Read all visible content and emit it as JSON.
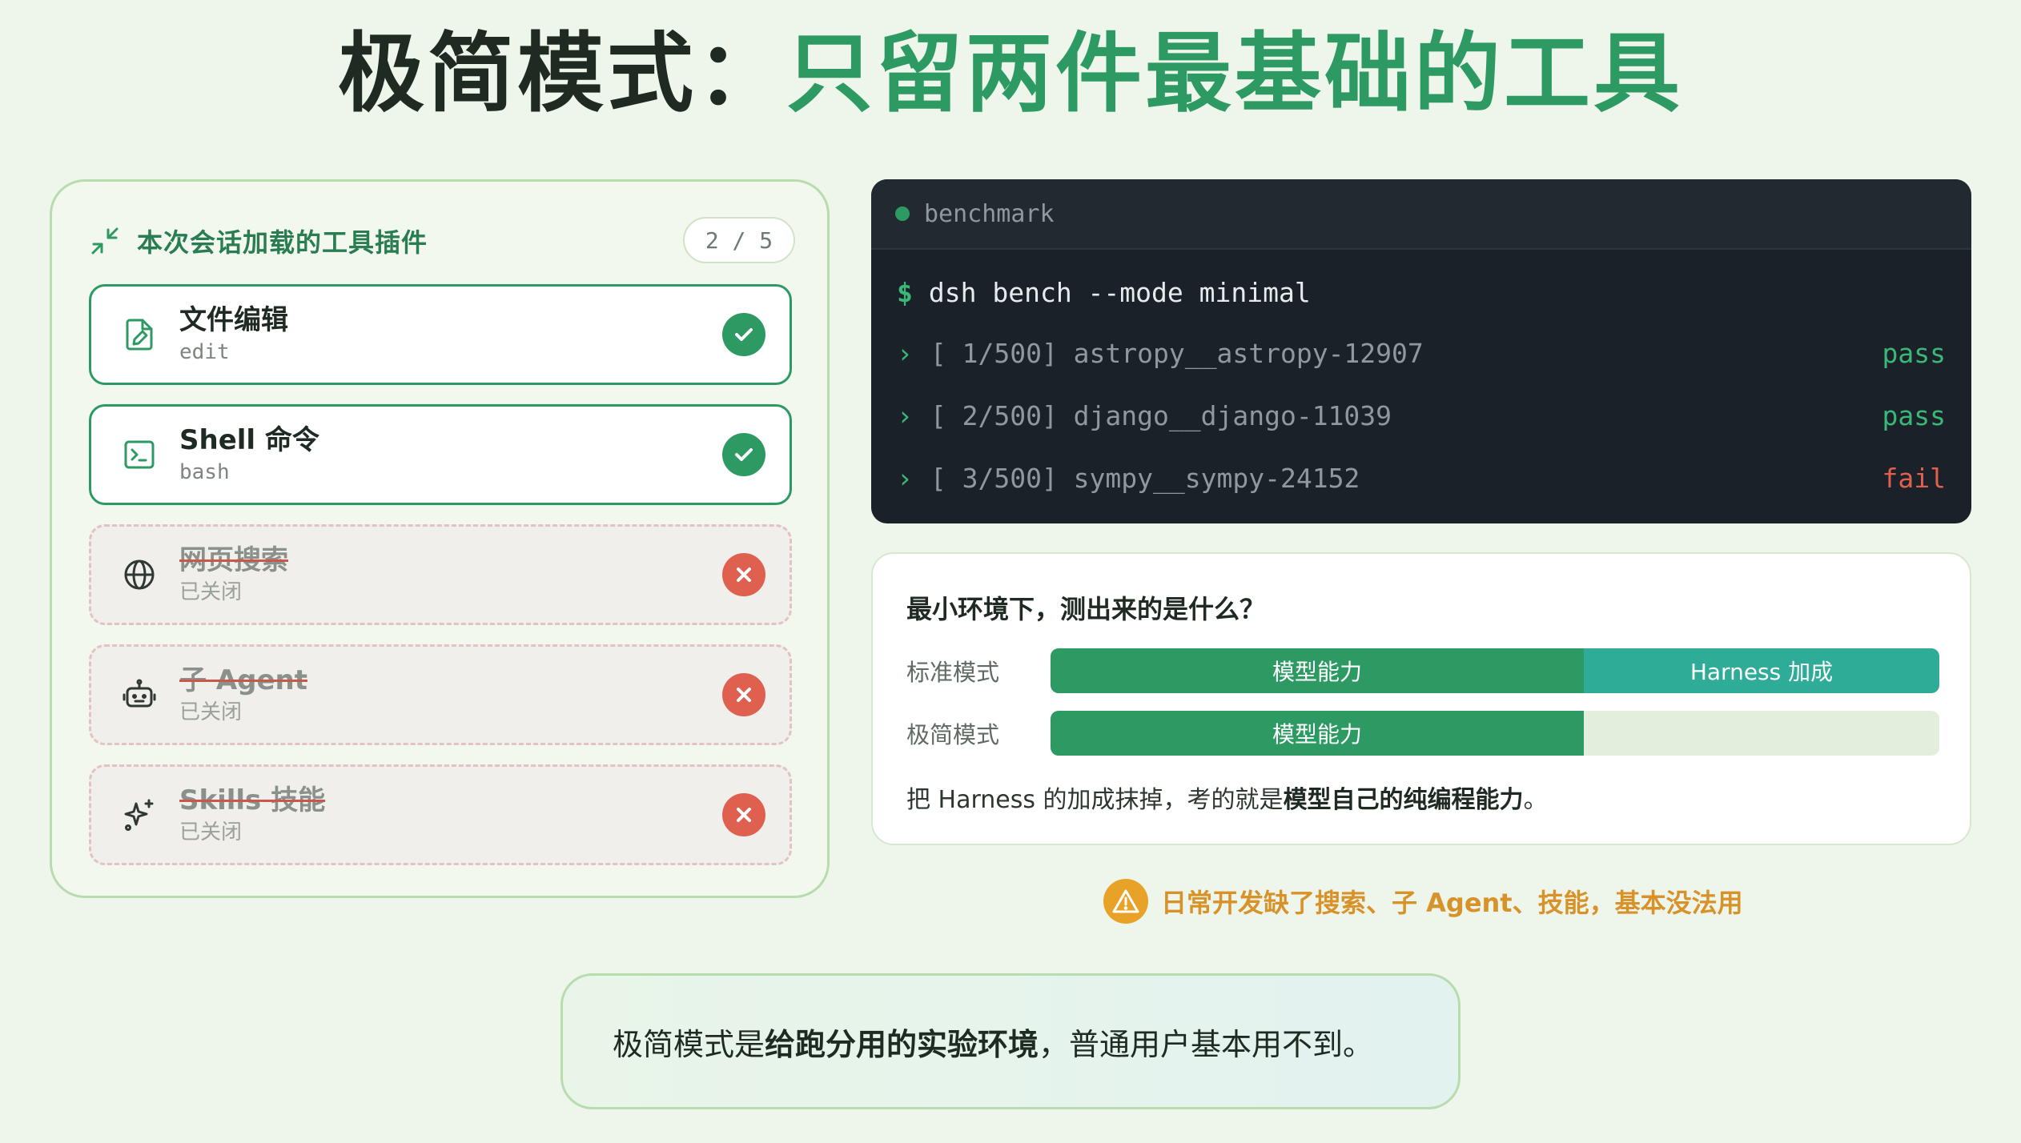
{
  "title": {
    "main": "极简模式：",
    "accent": "只留两件最基础的工具"
  },
  "tool_panel": {
    "header": "本次会话加载的工具插件",
    "counter": "2 / 5",
    "tools": [
      {
        "name": "文件编辑",
        "sub": "edit",
        "enabled": true,
        "icon": "file-edit-icon"
      },
      {
        "name": "Shell 命令",
        "sub": "bash",
        "enabled": true,
        "icon": "terminal-icon"
      },
      {
        "name": "网页搜索",
        "sub": "已关闭",
        "enabled": false,
        "icon": "globe-icon"
      },
      {
        "name": "子 Agent",
        "sub": "已关闭",
        "enabled": false,
        "icon": "robot-icon"
      },
      {
        "name": "Skills 技能",
        "sub": "已关闭",
        "enabled": false,
        "icon": "sparkle-icon"
      }
    ]
  },
  "terminal": {
    "title": "benchmark",
    "prompt": "$",
    "command": "dsh bench --mode minimal",
    "rows": [
      {
        "text": "[ 1/500] astropy__astropy-12907",
        "result": "pass"
      },
      {
        "text": "[ 2/500] django__django-11039",
        "result": "pass"
      },
      {
        "text": "[ 3/500] sympy__sympy-24152",
        "result": "fail"
      }
    ],
    "arrow": "›"
  },
  "compare": {
    "question": "最小环境下，测出来的是什么？",
    "standard": {
      "label": "标准模式",
      "model": "模型能力",
      "model_share": 0.6,
      "harness": "Harness 加成",
      "harness_share": 0.4
    },
    "minimal": {
      "label": "极简模式",
      "model": "模型能力",
      "model_share": 0.6
    },
    "note_prefix": "把 Harness 的加成抹掉，考的就是",
    "note_bold": "模型自己的纯编程能力",
    "note_suffix": "。"
  },
  "warning": "日常开发缺了搜索、子 Agent、技能，基本没法用",
  "callout": {
    "prefix": "极简模式是",
    "bold": "给跑分用的实验环境",
    "suffix": "，普通用户基本用不到。"
  },
  "colors": {
    "accent_green": "#2e9a63",
    "teal": "#2fac98",
    "fail_red": "#e0604f",
    "warn_orange": "#e8a227"
  }
}
